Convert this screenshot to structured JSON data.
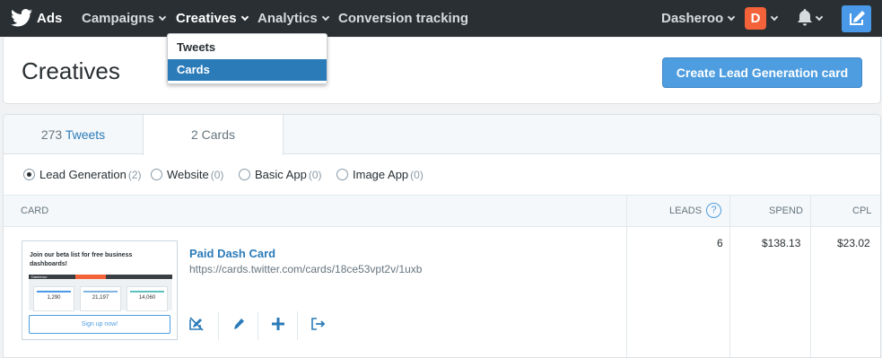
{
  "topnav": {
    "brand": "Ads",
    "items": [
      {
        "label": "Campaigns"
      },
      {
        "label": "Creatives"
      },
      {
        "label": "Analytics"
      },
      {
        "label": "Conversion tracking"
      }
    ],
    "account": "Dasheroo",
    "avatar_letter": "D"
  },
  "dropdown": {
    "items": [
      {
        "label": "Tweets"
      },
      {
        "label": "Cards"
      }
    ]
  },
  "header": {
    "title": "Creatives",
    "create_button": "Create Lead Generation card"
  },
  "tabs": {
    "tweets_count": "273",
    "tweets_label": "Tweets",
    "cards_label": "2 Cards"
  },
  "filters": [
    {
      "label": "Lead Generation",
      "count": "(2)",
      "selected": true
    },
    {
      "label": "Website",
      "count": "(0)",
      "selected": false
    },
    {
      "label": "Basic App",
      "count": "(0)",
      "selected": false
    },
    {
      "label": "Image App",
      "count": "(0)",
      "selected": false
    }
  ],
  "table": {
    "columns": {
      "card": "CARD",
      "leads": "LEADS",
      "leads_help": "?",
      "spend": "SPEND",
      "cpl": "CPL"
    },
    "rows": [
      {
        "name": "Paid Dash Card",
        "url": "https://cards.twitter.com/cards/18ce53vpt2v/1uxb",
        "leads": "6",
        "spend": "$138.13",
        "cpl": "$23.02",
        "thumb": {
          "headline": "Join our beta list for free business dashboards!",
          "brand": "Dasheroo",
          "stats": [
            "1,290",
            "21,197",
            "14,060"
          ],
          "cta": "Sign up now!"
        }
      }
    ]
  },
  "colors": {
    "nav_bg": "#292f33",
    "accent": "#4d9de0",
    "selected": "#2b7bb9",
    "avatar": "#f4623a"
  },
  "icons": {
    "brand": "twitter-bird-icon",
    "notifications": "bell-icon",
    "compose": "compose-icon",
    "row_actions": [
      "pause-card-icon",
      "edit-icon",
      "add-icon",
      "share-icon"
    ]
  }
}
